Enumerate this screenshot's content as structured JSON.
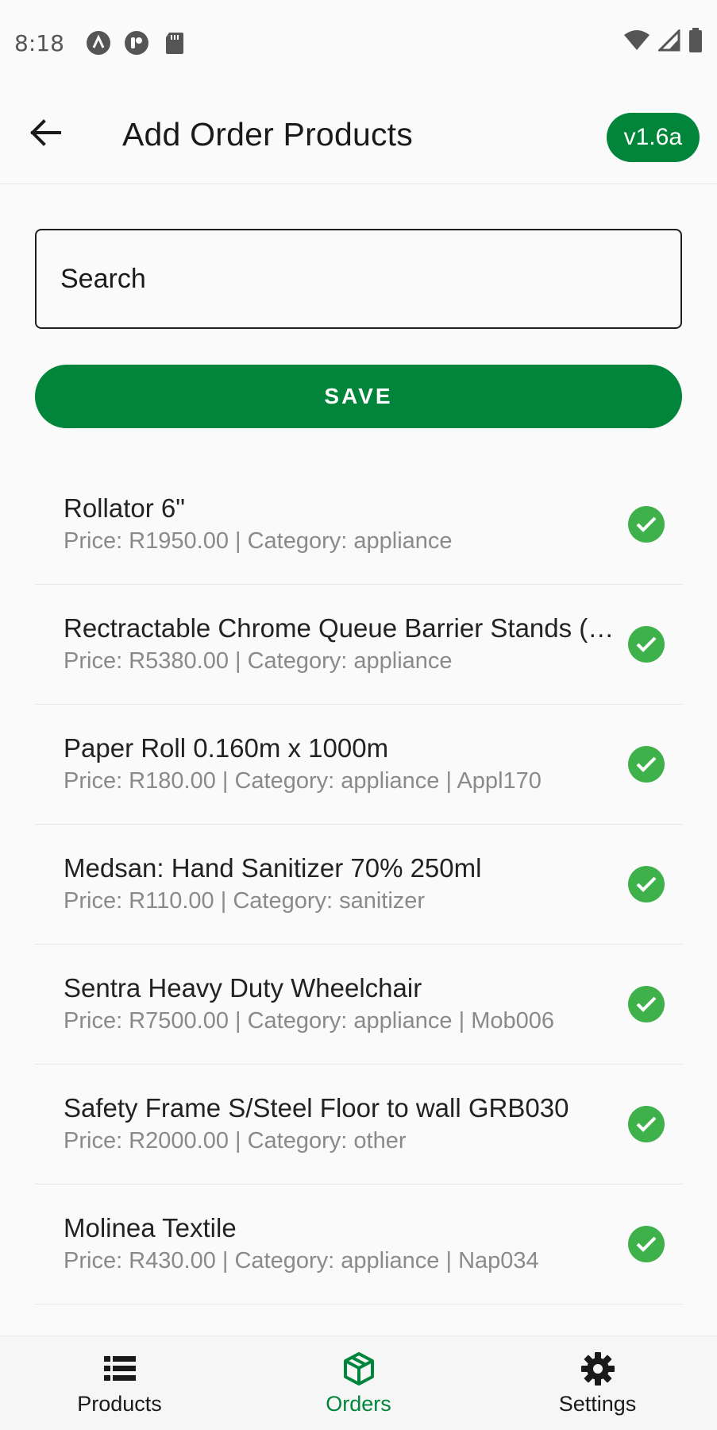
{
  "status_bar": {
    "time": "8:18",
    "icons": [
      "a-badge-icon",
      "notification-icon",
      "sd-card-icon",
      "wifi-icon",
      "signal-icon",
      "battery-icon"
    ]
  },
  "header": {
    "title": "Add Order Products",
    "version": "v1.6a",
    "back_icon": "arrow-left-icon"
  },
  "search": {
    "placeholder": "Search"
  },
  "save_button": {
    "label": "SAVE"
  },
  "products": [
    {
      "name": "Rollator 6\"",
      "details": "Price: R1950.00 | Category: appliance",
      "selected": true
    },
    {
      "name": "Rectractable Chrome Queue Barrier Stands (Black Band)",
      "details": "Price: R5380.00 | Category: appliance",
      "selected": true
    },
    {
      "name": "Paper Roll 0.160m x 1000m",
      "details": "Price: R180.00 | Category: appliance | Appl170",
      "selected": true
    },
    {
      "name": "Medsan: Hand Sanitizer 70% 250ml",
      "details": "Price: R110.00 | Category: sanitizer",
      "selected": true
    },
    {
      "name": "Sentra Heavy Duty Wheelchair",
      "details": "Price: R7500.00 | Category: appliance | Mob006",
      "selected": true
    },
    {
      "name": "Safety Frame S/Steel Floor to wall GRB030",
      "details": "Price: R2000.00 | Category: other",
      "selected": true
    },
    {
      "name": "Molinea Textile",
      "details": "Price: R430.00 | Category: appliance | Nap034",
      "selected": true
    }
  ],
  "bottom_nav": {
    "items": [
      {
        "label": "Products",
        "icon": "list-icon",
        "active": false
      },
      {
        "label": "Orders",
        "icon": "box-icon",
        "active": true
      },
      {
        "label": "Settings",
        "icon": "gear-icon",
        "active": false
      }
    ]
  },
  "colors": {
    "accent": "#00853a",
    "check": "#3fb14b",
    "secondary_text": "#8a8a8a"
  }
}
